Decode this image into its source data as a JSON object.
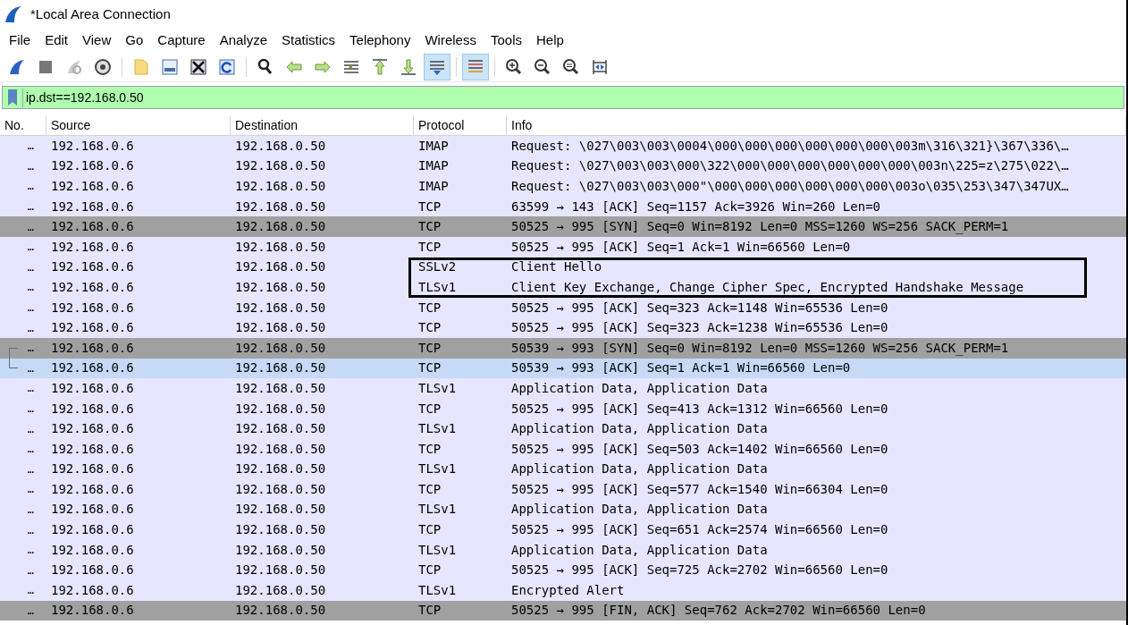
{
  "window": {
    "title": "*Local Area Connection"
  },
  "menu": [
    "File",
    "Edit",
    "View",
    "Go",
    "Capture",
    "Analyze",
    "Statistics",
    "Telephony",
    "Wireless",
    "Tools",
    "Help"
  ],
  "toolbar": [
    {
      "kind": "fin",
      "on": false
    },
    {
      "kind": "stop",
      "on": false
    },
    {
      "kind": "restart",
      "on": false
    },
    {
      "kind": "options",
      "on": false
    },
    {
      "kind": "open",
      "on": false
    },
    {
      "kind": "save",
      "on": false
    },
    {
      "kind": "close",
      "on": false
    },
    {
      "kind": "reload",
      "on": false
    },
    {
      "kind": "find",
      "on": false
    },
    {
      "kind": "back",
      "on": false
    },
    {
      "kind": "forward",
      "on": false
    },
    {
      "kind": "goto",
      "on": false
    },
    {
      "kind": "first",
      "on": false
    },
    {
      "kind": "last",
      "on": false
    },
    {
      "kind": "autoscroll",
      "on": true
    },
    {
      "kind": "colorize",
      "on": true
    },
    {
      "kind": "zoomin",
      "on": false
    },
    {
      "kind": "zoomout",
      "on": false
    },
    {
      "kind": "zoomreset",
      "on": false
    },
    {
      "kind": "resize",
      "on": false
    }
  ],
  "filter": {
    "value": "ip.dst==192.168.0.50"
  },
  "table": {
    "columns": [
      "No.",
      "Source",
      "Destination",
      "Protocol",
      "Info"
    ],
    "rows": [
      {
        "no": "…",
        "source": "192.168.0.6",
        "destination": "192.168.0.50",
        "protocol": "IMAP",
        "info": "Request: \\027\\003\\003\\0004\\000\\000\\000\\000\\000\\000\\003m\\316\\321}\\367\\336\\…",
        "kind": "normal",
        "selected": false,
        "highlighted": false
      },
      {
        "no": "…",
        "source": "192.168.0.6",
        "destination": "192.168.0.50",
        "protocol": "IMAP",
        "info": "Request: \\027\\003\\003\\000\\322\\000\\000\\000\\000\\000\\000\\003n\\225=z\\275\\022\\…",
        "kind": "normal",
        "selected": false,
        "highlighted": false
      },
      {
        "no": "…",
        "source": "192.168.0.6",
        "destination": "192.168.0.50",
        "protocol": "IMAP",
        "info": "Request: \\027\\003\\003\\000\"\\000\\000\\000\\000\\000\\000\\003o\\035\\253\\347\\347UX…",
        "kind": "normal",
        "selected": false,
        "highlighted": false
      },
      {
        "no": "…",
        "source": "192.168.0.6",
        "destination": "192.168.0.50",
        "protocol": "TCP",
        "info": "63599 → 143 [ACK] Seq=1157 Ack=3926 Win=260 Len=0",
        "kind": "normal",
        "selected": false,
        "highlighted": false
      },
      {
        "no": "…",
        "source": "192.168.0.6",
        "destination": "192.168.0.50",
        "protocol": "TCP",
        "info": "50525 → 995 [SYN] Seq=0 Win=8192 Len=0 MSS=1260 WS=256 SACK_PERM=1",
        "kind": "flags",
        "selected": false,
        "highlighted": false
      },
      {
        "no": "…",
        "source": "192.168.0.6",
        "destination": "192.168.0.50",
        "protocol": "TCP",
        "info": "50525 → 995 [ACK] Seq=1 Ack=1 Win=66560 Len=0",
        "kind": "normal",
        "selected": false,
        "highlighted": false
      },
      {
        "no": "…",
        "source": "192.168.0.6",
        "destination": "192.168.0.50",
        "protocol": "SSLv2",
        "info": "Client Hello",
        "kind": "normal",
        "selected": false,
        "highlighted": true
      },
      {
        "no": "…",
        "source": "192.168.0.6",
        "destination": "192.168.0.50",
        "protocol": "TLSv1",
        "info": "Client Key Exchange, Change Cipher Spec, Encrypted Handshake Message",
        "kind": "normal",
        "selected": false,
        "highlighted": true
      },
      {
        "no": "…",
        "source": "192.168.0.6",
        "destination": "192.168.0.50",
        "protocol": "TCP",
        "info": "50525 → 995 [ACK] Seq=323 Ack=1148 Win=65536 Len=0",
        "kind": "normal",
        "selected": false,
        "highlighted": false
      },
      {
        "no": "…",
        "source": "192.168.0.6",
        "destination": "192.168.0.50",
        "protocol": "TCP",
        "info": "50525 → 995 [ACK] Seq=323 Ack=1238 Win=65536 Len=0",
        "kind": "normal",
        "selected": false,
        "highlighted": false
      },
      {
        "no": "…",
        "source": "192.168.0.6",
        "destination": "192.168.0.50",
        "protocol": "TCP",
        "info": "50539 → 993 [SYN] Seq=0 Win=8192 Len=0 MSS=1260 WS=256 SACK_PERM=1",
        "kind": "flags",
        "selected": false,
        "highlighted": false,
        "related": true
      },
      {
        "no": "…",
        "source": "192.168.0.6",
        "destination": "192.168.0.50",
        "protocol": "TCP",
        "info": "50539 → 993 [ACK] Seq=1 Ack=1 Win=66560 Len=0",
        "kind": "normal",
        "selected": true,
        "highlighted": false,
        "related": true
      },
      {
        "no": "…",
        "source": "192.168.0.6",
        "destination": "192.168.0.50",
        "protocol": "TLSv1",
        "info": "Application Data, Application Data",
        "kind": "normal",
        "selected": false,
        "highlighted": false
      },
      {
        "no": "…",
        "source": "192.168.0.6",
        "destination": "192.168.0.50",
        "protocol": "TCP",
        "info": "50525 → 995 [ACK] Seq=413 Ack=1312 Win=66560 Len=0",
        "kind": "normal",
        "selected": false,
        "highlighted": false
      },
      {
        "no": "…",
        "source": "192.168.0.6",
        "destination": "192.168.0.50",
        "protocol": "TLSv1",
        "info": "Application Data, Application Data",
        "kind": "normal",
        "selected": false,
        "highlighted": false
      },
      {
        "no": "…",
        "source": "192.168.0.6",
        "destination": "192.168.0.50",
        "protocol": "TCP",
        "info": "50525 → 995 [ACK] Seq=503 Ack=1402 Win=66560 Len=0",
        "kind": "normal",
        "selected": false,
        "highlighted": false
      },
      {
        "no": "…",
        "source": "192.168.0.6",
        "destination": "192.168.0.50",
        "protocol": "TLSv1",
        "info": "Application Data, Application Data",
        "kind": "normal",
        "selected": false,
        "highlighted": false
      },
      {
        "no": "…",
        "source": "192.168.0.6",
        "destination": "192.168.0.50",
        "protocol": "TCP",
        "info": "50525 → 995 [ACK] Seq=577 Ack=1540 Win=66304 Len=0",
        "kind": "normal",
        "selected": false,
        "highlighted": false
      },
      {
        "no": "…",
        "source": "192.168.0.6",
        "destination": "192.168.0.50",
        "protocol": "TLSv1",
        "info": "Application Data, Application Data",
        "kind": "normal",
        "selected": false,
        "highlighted": false
      },
      {
        "no": "…",
        "source": "192.168.0.6",
        "destination": "192.168.0.50",
        "protocol": "TCP",
        "info": "50525 → 995 [ACK] Seq=651 Ack=2574 Win=66560 Len=0",
        "kind": "normal",
        "selected": false,
        "highlighted": false
      },
      {
        "no": "…",
        "source": "192.168.0.6",
        "destination": "192.168.0.50",
        "protocol": "TLSv1",
        "info": "Application Data, Application Data",
        "kind": "normal",
        "selected": false,
        "highlighted": false
      },
      {
        "no": "…",
        "source": "192.168.0.6",
        "destination": "192.168.0.50",
        "protocol": "TCP",
        "info": "50525 → 995 [ACK] Seq=725 Ack=2702 Win=66560 Len=0",
        "kind": "normal",
        "selected": false,
        "highlighted": false
      },
      {
        "no": "…",
        "source": "192.168.0.6",
        "destination": "192.168.0.50",
        "protocol": "TLSv1",
        "info": "Encrypted Alert",
        "kind": "normal",
        "selected": false,
        "highlighted": false
      },
      {
        "no": "…",
        "source": "192.168.0.6",
        "destination": "192.168.0.50",
        "protocol": "TCP",
        "info": "50525 → 995 [FIN, ACK] Seq=762 Ack=2702 Win=66560 Len=0",
        "kind": "flags",
        "selected": false,
        "highlighted": false
      }
    ]
  }
}
